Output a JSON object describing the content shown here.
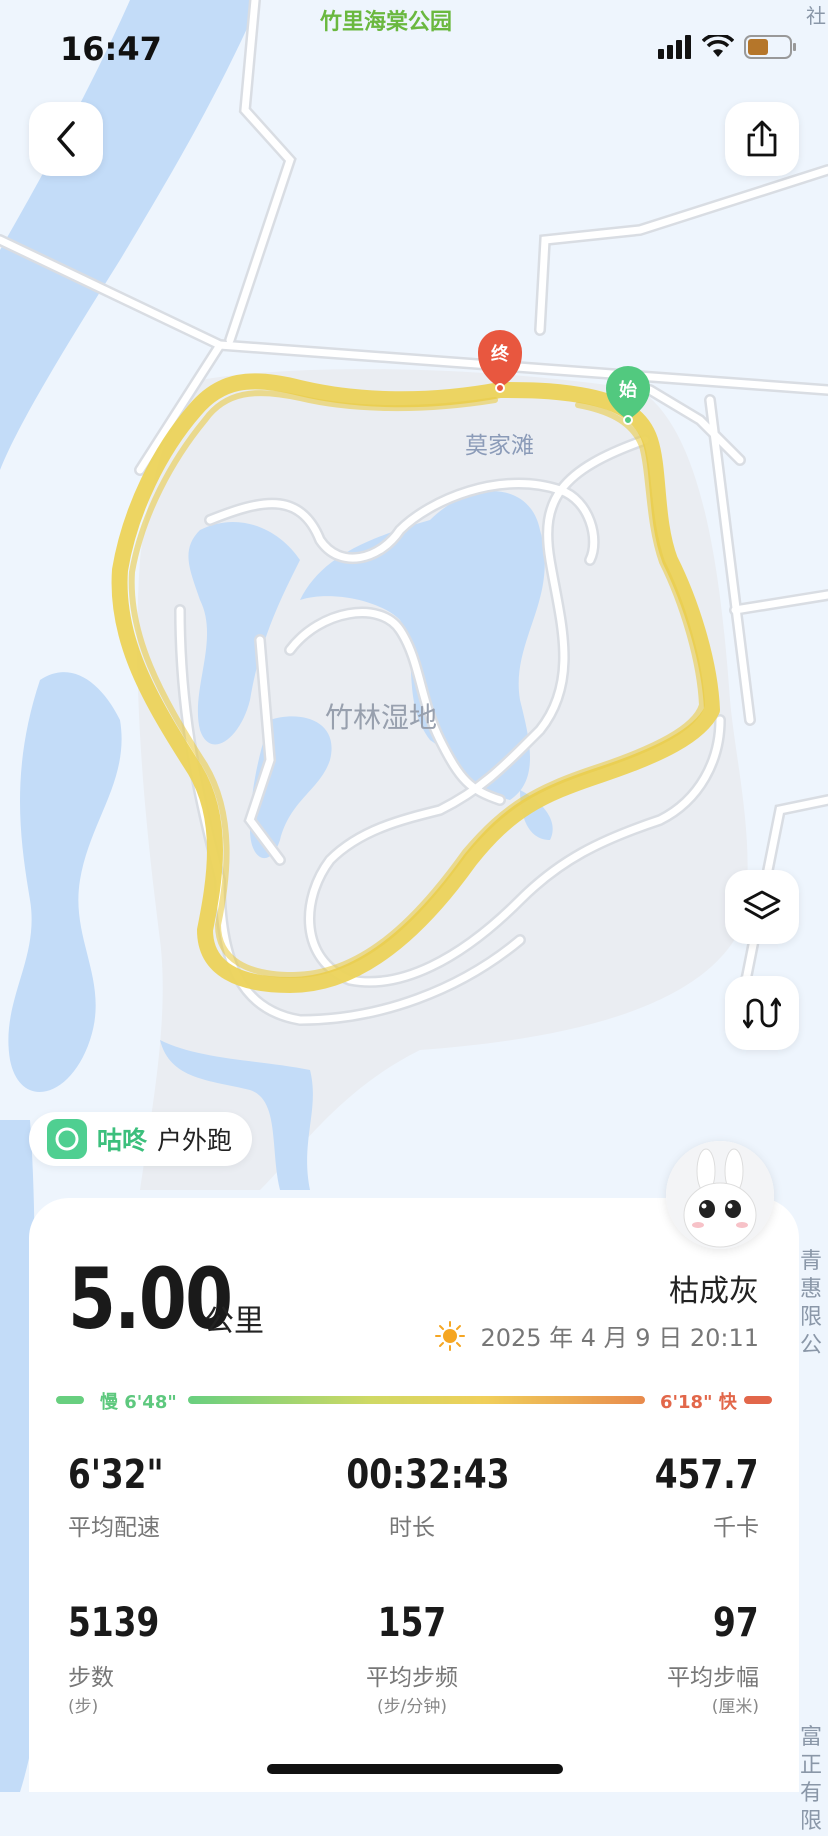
{
  "status_bar": {
    "time": "16:47"
  },
  "map": {
    "labels": {
      "top_park": "竹里海棠公园",
      "top_right_edge": "社",
      "village": "莫家滩",
      "wetland": "竹林湿地",
      "right_edge_1": "青惠",
      "right_edge_2": "限公",
      "bottom_right_1": "富正",
      "bottom_right_2": "有限"
    },
    "markers": {
      "end": "终",
      "start": "始"
    },
    "colors": {
      "route": "#ecd35a",
      "water": "#c3dcf8",
      "land": "#eef5fd",
      "park": "#eaedf2",
      "road": "#ffffff",
      "start": "#52c97f",
      "end": "#e8573f"
    }
  },
  "toolbar": {
    "back_icon": "chevron-left-icon",
    "share_icon": "share-icon",
    "layers_icon": "layers-icon",
    "route_icon": "route-icon"
  },
  "brand": {
    "name": "咕咚",
    "activity": "户外跑"
  },
  "summary": {
    "distance": "5.00",
    "distance_unit": "公里",
    "user_name": "枯成灰",
    "datetime": "2025 年 4 月 9 日 20:11",
    "weather_icon": "sun-icon",
    "pace_slow": "慢 6'48\"",
    "pace_fast": "6'18\" 快"
  },
  "stats": [
    {
      "value": "6'32\"",
      "label": "平均配速",
      "unit": ""
    },
    {
      "value": "00:32:43",
      "label": "时长",
      "unit": ""
    },
    {
      "value": "457.7",
      "label": "千卡",
      "unit": ""
    },
    {
      "value": "5139",
      "label": "步数",
      "unit": "(步)"
    },
    {
      "value": "157",
      "label": "平均步频",
      "unit": "(步/分钟)"
    },
    {
      "value": "97",
      "label": "平均步幅",
      "unit": "(厘米)"
    }
  ]
}
